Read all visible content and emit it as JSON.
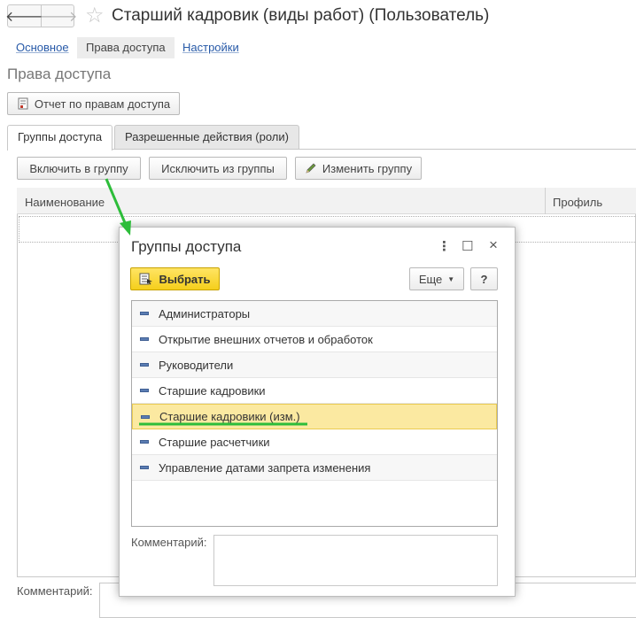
{
  "window": {
    "title": "Старший кадровик (виды работ) (Пользователь)",
    "back_icon": "arrow-left",
    "forward_icon": "arrow-right",
    "favorite_icon": "star"
  },
  "page_tabs": [
    "Основное",
    "Права доступа",
    "Настройки"
  ],
  "section_title": "Права доступа",
  "report_button": "Отчет по правам доступа",
  "inner_tabs": [
    "Группы доступа",
    "Разрешенные действия (роли)"
  ],
  "toolbar": {
    "include": "Включить в группу",
    "exclude": "Исключить из группы",
    "edit": "Изменить группу"
  },
  "table": {
    "columns": [
      "Наименование",
      "Профиль"
    ]
  },
  "bottom": {
    "comment_label": "Комментарий:"
  },
  "modal": {
    "title": "Группы доступа",
    "menu_icon": "⋮",
    "maximize_icon": "☐",
    "close_icon": "×",
    "select_button": "Выбрать",
    "more_button": "Еще",
    "help_button": "?",
    "groups": [
      "Администраторы",
      "Открытие внешних отчетов и обработок",
      "Руководители",
      "Старшие кадровики",
      "Старшие кадровики (изм.)",
      "Старшие расчетчики",
      "Управление датами запрета изменения"
    ],
    "selected_index": 4,
    "comment_label": "Комментарий:"
  },
  "colors": {
    "accent_yellow": "#f5cf1b",
    "selected_row": "#fbe9a1",
    "annotation_green": "#2dbd3a",
    "link_blue": "#285aa8"
  }
}
